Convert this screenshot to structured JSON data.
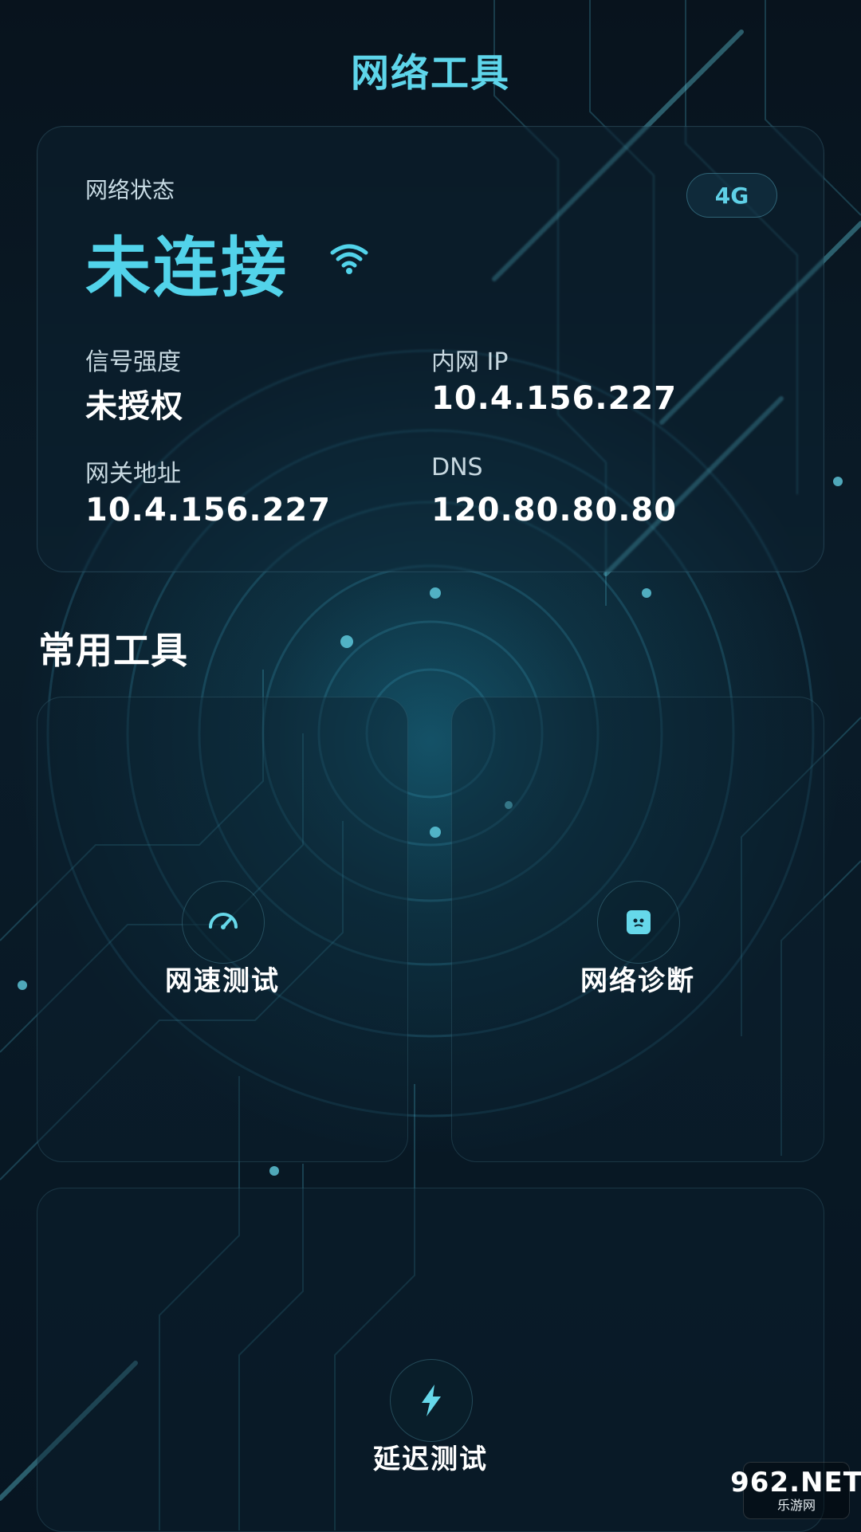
{
  "header": {
    "title": "网络工具"
  },
  "network_status": {
    "label": "网络状态",
    "value": "未连接",
    "network_type_badge": "4G",
    "signal_strength": {
      "label": "信号强度",
      "value": "未授权"
    },
    "intranet_ip": {
      "label": "内网 IP",
      "value": "10.4.156.227"
    },
    "gateway": {
      "label": "网关地址",
      "value": "10.4.156.227"
    },
    "dns": {
      "label": "DNS",
      "value": "120.80.80.80"
    }
  },
  "tools": {
    "section_title": "常用工具",
    "items": [
      {
        "label": "网速测试",
        "icon": "speedometer-icon"
      },
      {
        "label": "网络诊断",
        "icon": "diagnosis-icon"
      },
      {
        "label": "延迟测试",
        "icon": "lightning-icon"
      }
    ]
  },
  "watermark": {
    "top": "962.NET",
    "bottom": "乐游网"
  },
  "colors": {
    "accent": "#52d3ea",
    "background": "#061420",
    "card": "#0e2837"
  }
}
